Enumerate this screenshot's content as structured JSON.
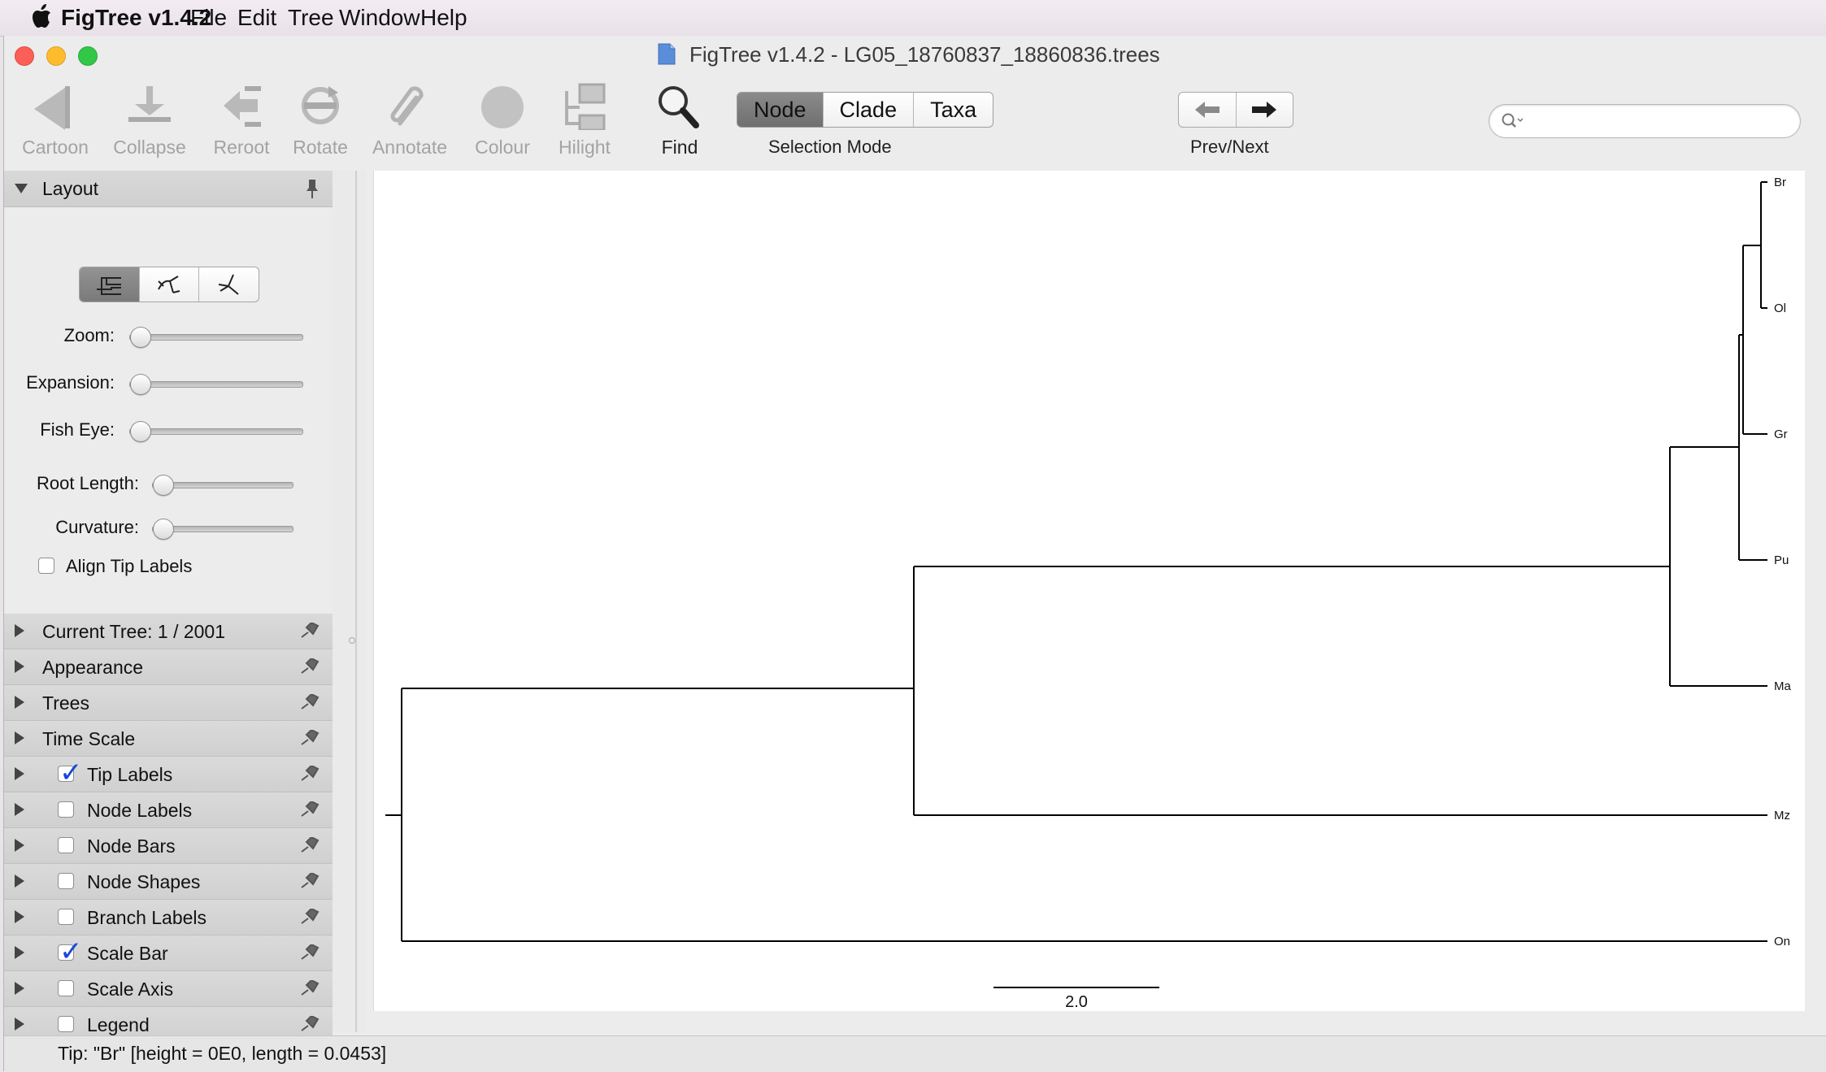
{
  "menubar": {
    "app_name": "FigTree v1.4.2",
    "items": [
      "File",
      "Edit",
      "Tree",
      "Window",
      "Help"
    ]
  },
  "window": {
    "title": "FigTree v1.4.2 - LG05_18760837_18860836.trees"
  },
  "toolbar": {
    "buttons": [
      {
        "label": "Cartoon",
        "icon": "cartoon-icon",
        "enabled": false
      },
      {
        "label": "Collapse",
        "icon": "collapse-icon",
        "enabled": false
      },
      {
        "label": "Reroot",
        "icon": "reroot-icon",
        "enabled": false
      },
      {
        "label": "Rotate",
        "icon": "rotate-icon",
        "enabled": false
      },
      {
        "label": "Annotate",
        "icon": "paperclip-icon",
        "enabled": false
      },
      {
        "label": "Colour",
        "icon": "colour-circle-icon",
        "enabled": false
      },
      {
        "label": "Hilight",
        "icon": "hilight-icon",
        "enabled": false
      },
      {
        "label": "Find",
        "icon": "magnifier-icon",
        "enabled": true
      }
    ],
    "selection_mode": {
      "options": [
        "Node",
        "Clade",
        "Taxa"
      ],
      "selected": "Node",
      "label": "Selection Mode"
    },
    "prev_next_label": "Prev/Next",
    "search_placeholder": ""
  },
  "panel": {
    "layout": {
      "title": "Layout",
      "sliders": [
        {
          "label": "Zoom:",
          "value": 0
        },
        {
          "label": "Expansion:",
          "value": 0
        },
        {
          "label": "Fish Eye:",
          "value": 0
        },
        {
          "label": "Root Length:",
          "value": 0
        },
        {
          "label": "Curvature:",
          "value": 0
        }
      ],
      "align_tip_labels": {
        "label": "Align Tip Labels",
        "checked": false
      }
    },
    "sections": [
      {
        "label": "Current Tree: 1 / 2001",
        "checkbox": null
      },
      {
        "label": "Appearance",
        "checkbox": null
      },
      {
        "label": "Trees",
        "checkbox": null
      },
      {
        "label": "Time Scale",
        "checkbox": null
      },
      {
        "label": "Tip Labels",
        "checkbox": true
      },
      {
        "label": "Node Labels",
        "checkbox": false
      },
      {
        "label": "Node Bars",
        "checkbox": false
      },
      {
        "label": "Node Shapes",
        "checkbox": false
      },
      {
        "label": "Branch Labels",
        "checkbox": false
      },
      {
        "label": "Scale Bar",
        "checkbox": true
      },
      {
        "label": "Scale Axis",
        "checkbox": false
      },
      {
        "label": "Legend",
        "checkbox": false
      }
    ]
  },
  "tree": {
    "tips": [
      "Br",
      "Ol",
      "Gr",
      "Pu",
      "Ma",
      "Mz",
      "On"
    ],
    "scale_bar_label": "2.0"
  },
  "status": {
    "text": "Tip: \"Br\" [height = 0E0, length = 0.0453]"
  }
}
